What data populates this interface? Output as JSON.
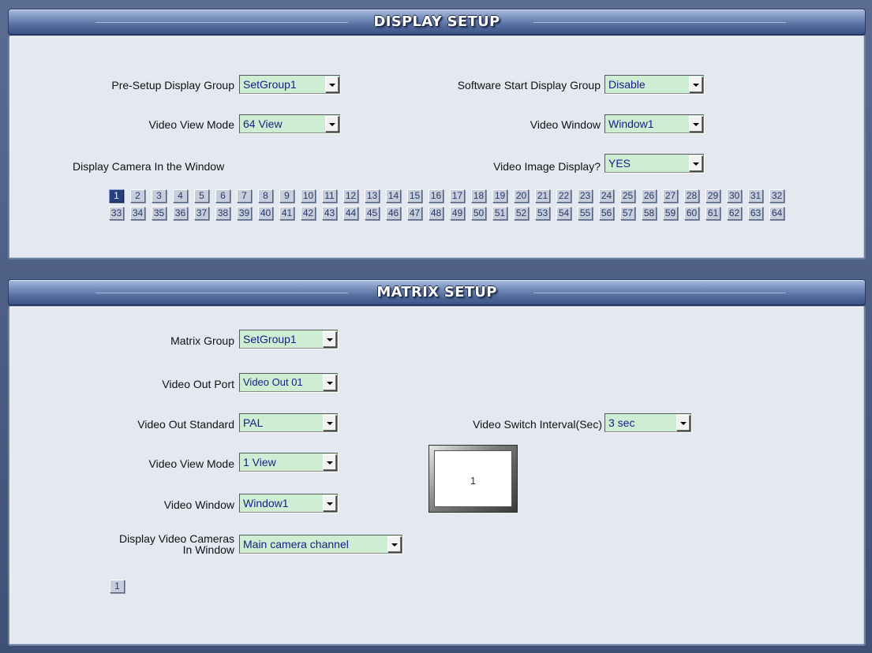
{
  "display_setup": {
    "title": "DISPLAY SETUP",
    "pre_setup_group": {
      "label": "Pre-Setup  Display Group",
      "value": "SetGroup1"
    },
    "software_start_group": {
      "label": "Software Start Display Group",
      "value": "Disable"
    },
    "video_view_mode": {
      "label": "Video View Mode",
      "value": "64 View"
    },
    "video_window": {
      "label": "Video Window",
      "value": "Window1"
    },
    "display_camera_label": "Display Camera In the Window",
    "video_image_display": {
      "label": "Video Image Display?",
      "value": "YES"
    },
    "cameras": [
      "1",
      "2",
      "3",
      "4",
      "5",
      "6",
      "7",
      "8",
      "9",
      "10",
      "11",
      "12",
      "13",
      "14",
      "15",
      "16",
      "17",
      "18",
      "19",
      "20",
      "21",
      "22",
      "23",
      "24",
      "25",
      "26",
      "27",
      "28",
      "29",
      "30",
      "31",
      "32",
      "33",
      "34",
      "35",
      "36",
      "37",
      "38",
      "39",
      "40",
      "41",
      "42",
      "43",
      "44",
      "45",
      "46",
      "47",
      "48",
      "49",
      "50",
      "51",
      "52",
      "53",
      "54",
      "55",
      "56",
      "57",
      "58",
      "59",
      "60",
      "61",
      "62",
      "63",
      "64"
    ],
    "selected_camera": "1"
  },
  "matrix_setup": {
    "title": "MATRIX SETUP",
    "matrix_group": {
      "label": "Matrix Group",
      "value": "SetGroup1"
    },
    "video_out_port": {
      "label": "Video Out Port",
      "value": "Video Out 01"
    },
    "video_out_standard": {
      "label": "Video Out Standard",
      "value": "PAL"
    },
    "video_switch_interval": {
      "label": "Video Switch Interval(Sec)",
      "value": "3 sec"
    },
    "video_view_mode": {
      "label": "Video View Mode",
      "value": "1 View"
    },
    "video_window": {
      "label": "Video Window",
      "value": "Window1"
    },
    "display_cameras": {
      "label_line1": "Display Video Cameras",
      "label_line2": "In Window",
      "value": "Main camera channel"
    },
    "preview_number": "1",
    "cameras": [
      "1"
    ]
  }
}
